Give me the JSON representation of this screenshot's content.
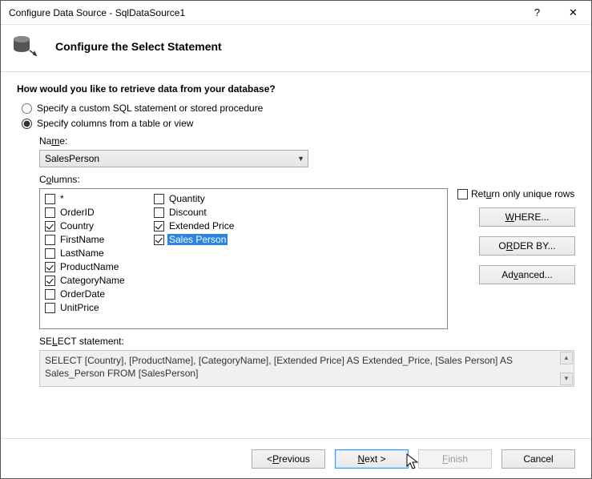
{
  "window": {
    "title": "Configure Data Source - SqlDataSource1",
    "help": "?",
    "close": "✕"
  },
  "header": {
    "title": "Configure the Select Statement"
  },
  "question": "How would you like to retrieve data from your database?",
  "radios": {
    "custom": "Specify a custom SQL statement or stored procedure",
    "table": "Specify columns from a table or view"
  },
  "name_label": "Name:",
  "name_value": "SalesPerson",
  "columns_label": "Columns:",
  "columns": {
    "col1": [
      {
        "label": "*",
        "checked": false
      },
      {
        "label": "OrderID",
        "checked": false
      },
      {
        "label": "Country",
        "checked": true
      },
      {
        "label": "FirstName",
        "checked": false
      },
      {
        "label": "LastName",
        "checked": false
      },
      {
        "label": "ProductName",
        "checked": true
      },
      {
        "label": "CategoryName",
        "checked": true
      },
      {
        "label": "OrderDate",
        "checked": false
      },
      {
        "label": "UnitPrice",
        "checked": false
      }
    ],
    "col2": [
      {
        "label": "Quantity",
        "checked": false
      },
      {
        "label": "Discount",
        "checked": false
      },
      {
        "label": "Extended Price",
        "checked": true
      },
      {
        "label": "Sales Person",
        "checked": true,
        "selected": true
      }
    ]
  },
  "side": {
    "unique": "Return only unique rows",
    "where": "WHERE...",
    "orderby": "ORDER BY...",
    "advanced": "Advanced..."
  },
  "stmt_label": "SELECT statement:",
  "stmt": "SELECT [Country], [ProductName], [CategoryName], [Extended Price] AS Extended_Price, [Sales Person] AS Sales_Person FROM [SalesPerson]",
  "footer": {
    "prev": "< Previous",
    "next": "Next >",
    "finish": "Finish",
    "cancel": "Cancel"
  }
}
